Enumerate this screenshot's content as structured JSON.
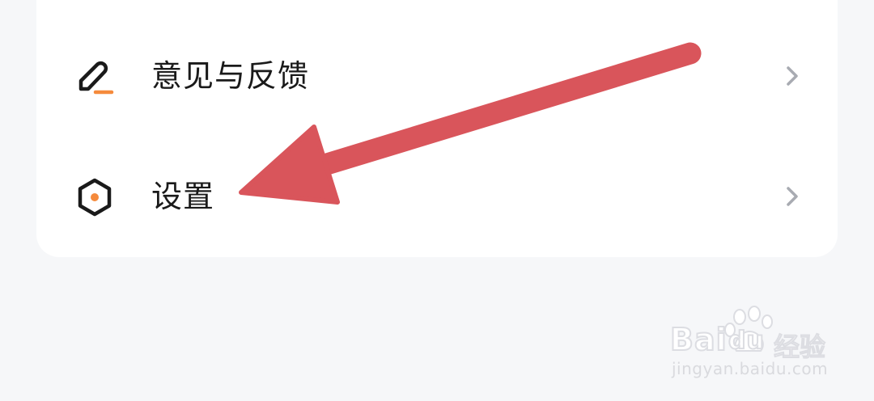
{
  "menu": {
    "items": [
      {
        "label": "意见与反馈",
        "icon": "pencil-icon"
      },
      {
        "label": "设置",
        "icon": "hexagon-settings-icon"
      }
    ]
  },
  "colors": {
    "accent": "#f58a3c",
    "arrow": "#d9555b",
    "text": "#1a1a1a",
    "chevron": "#a8abb2",
    "background": "#f6f7f9",
    "card": "#ffffff"
  },
  "watermark": {
    "brand": "Bai",
    "brand_suffix": "du",
    "brand_cn": "经验",
    "url": "jingyan.baidu.com"
  }
}
